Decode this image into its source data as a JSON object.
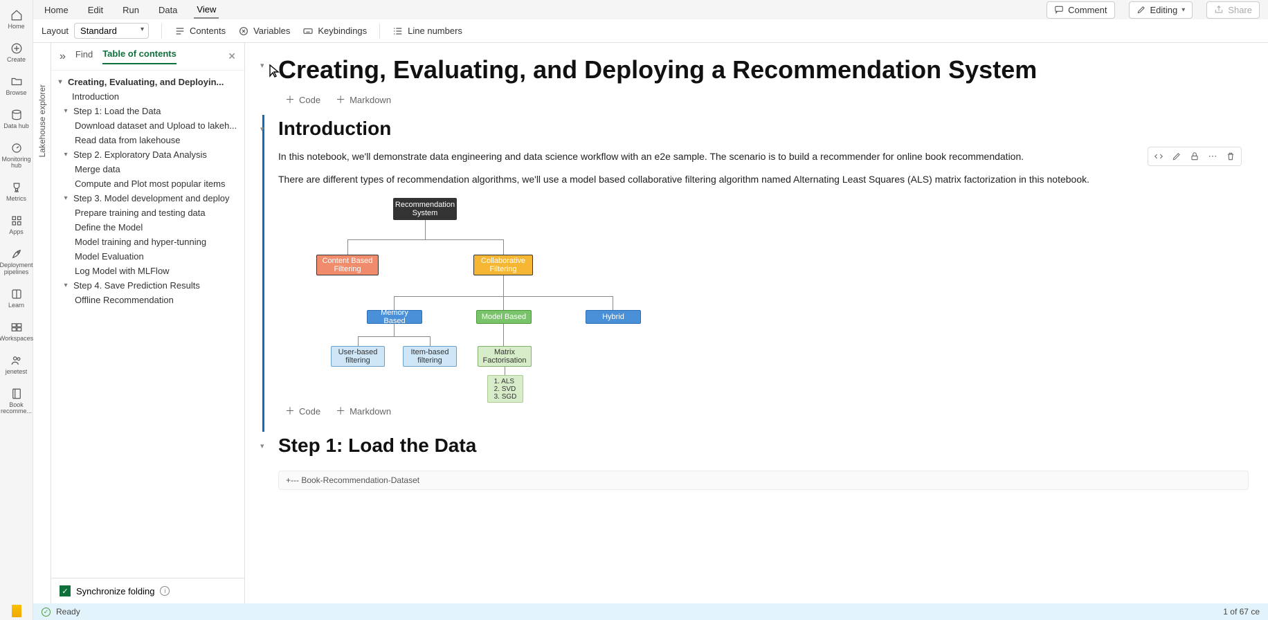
{
  "rail": {
    "items": [
      {
        "label": "Home"
      },
      {
        "label": "Create"
      },
      {
        "label": "Browse"
      },
      {
        "label": "Data hub"
      },
      {
        "label": "Monitoring hub"
      },
      {
        "label": "Metrics"
      },
      {
        "label": "Apps"
      },
      {
        "label": "Deployment pipelines"
      },
      {
        "label": "Learn"
      },
      {
        "label": "Workspaces"
      },
      {
        "label": "jenetest"
      },
      {
        "label": "Book recomme..."
      }
    ],
    "bottom_label": "Power BI"
  },
  "menubar": {
    "items": [
      "Home",
      "Edit",
      "Run",
      "Data",
      "View"
    ],
    "active_index": 4,
    "comment": "Comment",
    "editing": "Editing",
    "share": "Share"
  },
  "toolbar": {
    "layout_label": "Layout",
    "layout_value": "Standard",
    "contents": "Contents",
    "variables": "Variables",
    "keybindings": "Keybindings",
    "linenumbers": "Line numbers"
  },
  "lakehouse": {
    "label": "Lakehouse explorer"
  },
  "toc": {
    "find": "Find",
    "toc_tab": "Table of contents",
    "root": "Creating, Evaluating, and Deployin...",
    "items": [
      {
        "label": "Introduction",
        "level": 1
      },
      {
        "label": "Step 1: Load the Data",
        "level": 1,
        "hasChildren": true
      },
      {
        "label": "Download dataset and Upload to lakeh...",
        "level": 2
      },
      {
        "label": "Read data from lakehouse",
        "level": 2
      },
      {
        "label": "Step 2. Exploratory Data Analysis",
        "level": 1,
        "hasChildren": true
      },
      {
        "label": "Merge data",
        "level": 2
      },
      {
        "label": "Compute and Plot most popular items",
        "level": 2
      },
      {
        "label": "Step 3. Model development and deploy",
        "level": 1,
        "hasChildren": true
      },
      {
        "label": "Prepare training and testing data",
        "level": 2
      },
      {
        "label": "Define the Model",
        "level": 2
      },
      {
        "label": "Model training and hyper-tunning",
        "level": 2
      },
      {
        "label": "Model Evaluation",
        "level": 2
      },
      {
        "label": "Log Model with MLFlow",
        "level": 2
      },
      {
        "label": "Step 4. Save Prediction Results",
        "level": 1,
        "hasChildren": true
      },
      {
        "label": "Offline Recommendation",
        "level": 2
      }
    ],
    "sync": "Synchronize folding"
  },
  "editor": {
    "title": "Creating, Evaluating, and Deploying a Recommendation System",
    "intro_heading": "Introduction",
    "add_code": "Code",
    "add_markdown": "Markdown",
    "para1": "In this notebook, we'll demonstrate data engineering and data science workflow with an e2e sample. The scenario is to build a recommender for online book recommendation.",
    "para2": "There are different types of recommendation algorithms, we'll use a model based collaborative filtering algorithm named Alternating Least Squares (ALS) matrix factorization in this notebook.",
    "step1_heading": "Step 1: Load the Data",
    "code_preview": "+--- Book-Recommendation-Dataset"
  },
  "diagram": {
    "root": "Recommendation System",
    "content_based": "Content Based Filtering",
    "collaborative": "Collaborative Filtering",
    "memory": "Memory Based",
    "model": "Model Based",
    "hybrid": "Hybrid",
    "user": "User-based filtering",
    "item": "Item-based filtering",
    "matrix": "Matrix Factorisation",
    "algos": "1. ALS\n2. SVD\n3. SGD"
  },
  "status": {
    "ready": "Ready",
    "cells": "1 of 67 ce"
  }
}
